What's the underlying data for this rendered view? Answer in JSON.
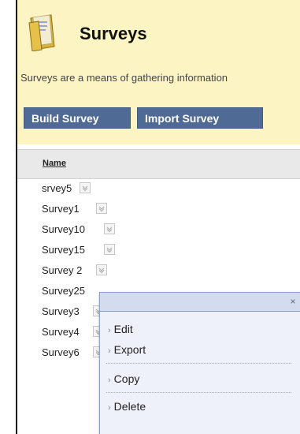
{
  "page": {
    "title": "Surveys",
    "description": "Surveys are a means of gathering information"
  },
  "buttons": {
    "build": "Build Survey",
    "import": "Import Survey"
  },
  "list": {
    "column_name": "Name",
    "rows": [
      {
        "label": "srvey5"
      },
      {
        "label": "Survey1"
      },
      {
        "label": "Survey10"
      },
      {
        "label": "Survey15"
      },
      {
        "label": "Survey 2"
      },
      {
        "label": "Survey25"
      },
      {
        "label": "Survey3"
      },
      {
        "label": "Survey4"
      },
      {
        "label": "Survey6"
      }
    ]
  },
  "context_menu": {
    "close": "×",
    "items": [
      {
        "label": "Edit"
      },
      {
        "label": "Export"
      },
      {
        "label": "Copy"
      },
      {
        "label": "Delete"
      }
    ]
  },
  "colors": {
    "header_bg": "#fdf4c4",
    "button_bg": "#4f6b95",
    "menu_bg": "#eef1fa"
  }
}
